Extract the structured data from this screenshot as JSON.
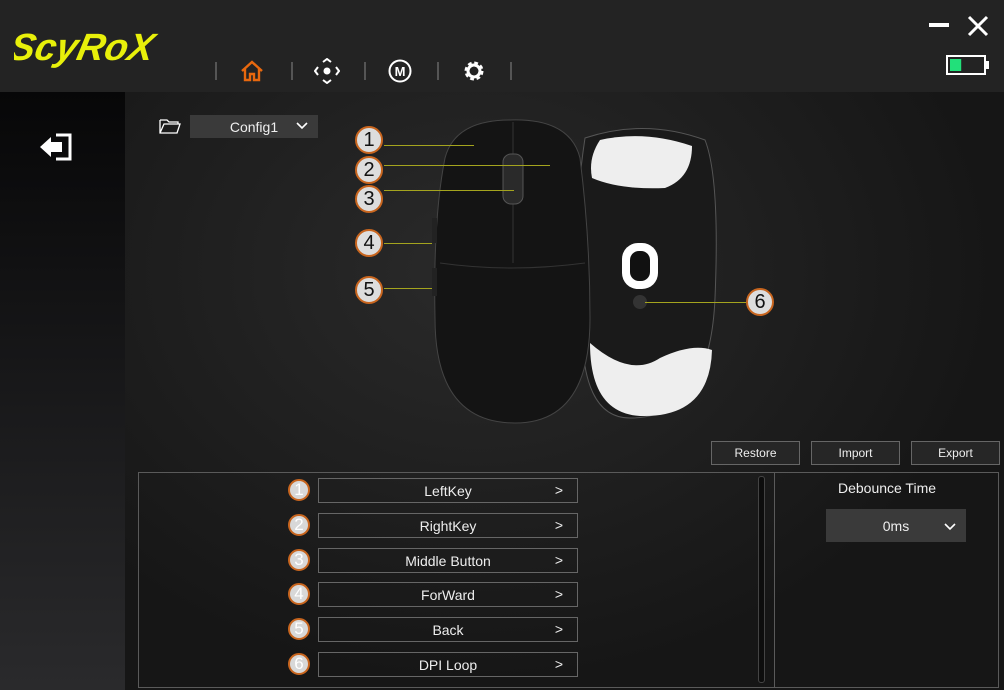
{
  "app": {
    "brand": "ScyRoX"
  },
  "nav": [
    {
      "name": "home",
      "active": true
    },
    {
      "name": "dpi"
    },
    {
      "name": "macro"
    },
    {
      "name": "settings"
    }
  ],
  "colors": {
    "accent": "#e8680e",
    "logo": "#e8f00a",
    "battery": "#22e07a"
  },
  "battery_level": 0.35,
  "config": {
    "selected": "Config1"
  },
  "callouts": [
    "1",
    "2",
    "3",
    "4",
    "5",
    "6"
  ],
  "actions": {
    "restore": "Restore",
    "import": "Import",
    "export": "Export"
  },
  "buttons": [
    {
      "num": "1",
      "label": "LeftKey"
    },
    {
      "num": "2",
      "label": "RightKey"
    },
    {
      "num": "3",
      "label": "Middle Button"
    },
    {
      "num": "4",
      "label": "ForWard"
    },
    {
      "num": "5",
      "label": "Back"
    },
    {
      "num": "6",
      "label": "DPI Loop"
    }
  ],
  "chevron": ">",
  "debounce": {
    "title": "Debounce Time",
    "value": "0ms"
  }
}
